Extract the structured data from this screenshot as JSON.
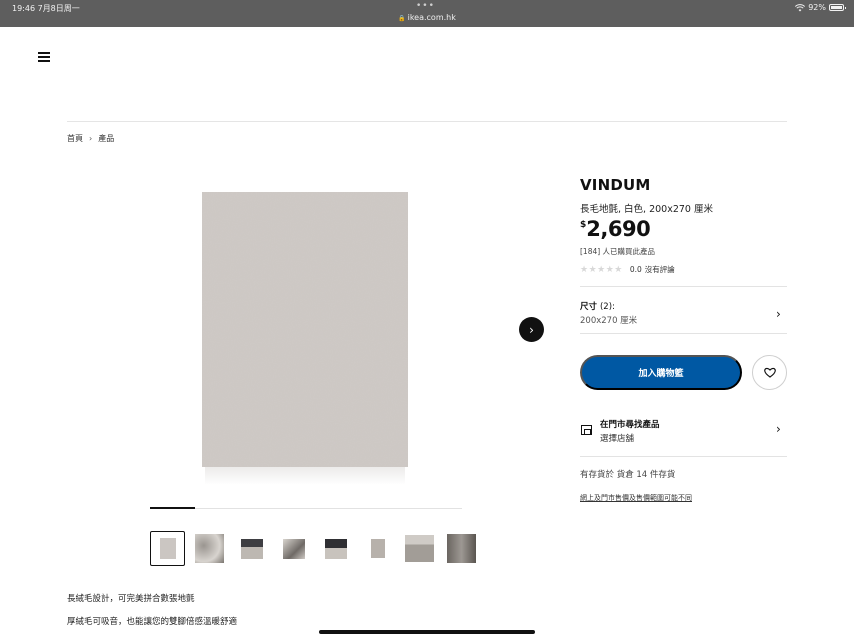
{
  "status_bar": {
    "time_date": "19:46  7月8日周一",
    "url": "ikea.com.hk",
    "battery": "92%"
  },
  "breadcrumb": [
    "首頁",
    "產品"
  ],
  "product": {
    "name": "VINDUM",
    "description": "長毛地氈, 白色, 200x270 厘米",
    "currency": "$",
    "price": "2,690",
    "bought": "[184] 人已購買此產品",
    "rating_value": "0.0",
    "rating_text": "沒有評論",
    "stars_filled": 0,
    "stars_total": 5
  },
  "size": {
    "label": "尺寸",
    "count": "(2):",
    "value": "200x270 厘米"
  },
  "actions": {
    "add_to_cart": "加入購物籃"
  },
  "store": {
    "title": "在門市尋找產品",
    "subtitle": "選擇店舖"
  },
  "stock": "有存貨於 貨倉 14 件存貨",
  "policy_link": "網上及門市售價及售價範圍可能不同",
  "gallery": {
    "thumbnail_count": 8,
    "active_index": 0
  },
  "details": [
    "長絨毛設計，可完美拼合數張地氈",
    "厚絨毛可吸音，也能讓您的雙腳倍感溫暖舒適"
  ],
  "colors": {
    "accent": "#0058a3",
    "rug": "#cdc8c4"
  }
}
